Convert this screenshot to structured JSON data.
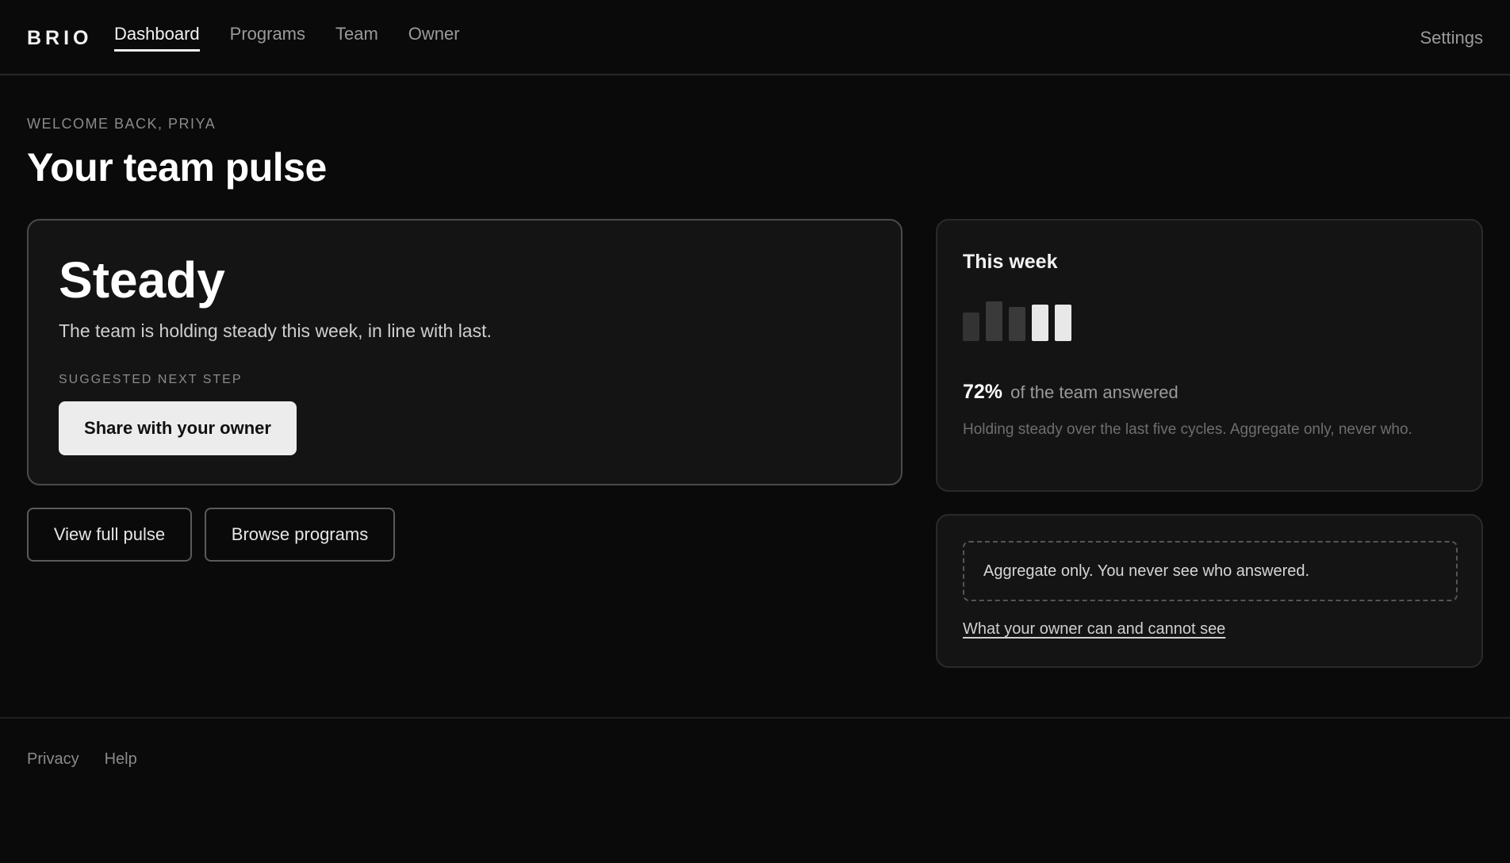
{
  "nav": {
    "brand": "BRIO",
    "links": [
      {
        "label": "Dashboard",
        "active": true
      },
      {
        "label": "Programs",
        "active": false
      },
      {
        "label": "Team",
        "active": false
      },
      {
        "label": "Owner",
        "active": false
      }
    ],
    "settings": "Settings"
  },
  "header": {
    "eyebrow": "WELCOME BACK, PRIYA",
    "title": "Your team pulse"
  },
  "pulse": {
    "status": "Steady",
    "description": "The team is holding steady this week, in line with last.",
    "next_step_label": "SUGGESTED NEXT STEP",
    "share_button": "Share with your owner"
  },
  "actions": {
    "view_full": "View full pulse",
    "browse": "Browse programs"
  },
  "this_week": {
    "title": "This week",
    "percent": "72%",
    "percent_suffix": "of the team answered",
    "note": "Holding steady over the last five cycles. Aggregate only, never who."
  },
  "chart_data": {
    "type": "bar",
    "values": [
      36,
      50,
      43,
      46,
      46
    ],
    "colors": [
      "#333333",
      "#3a3a3a",
      "#3a3a3a",
      "#e8e8e8",
      "#e8e8e8"
    ],
    "ylim": [
      0,
      50
    ]
  },
  "privacy": {
    "notice": "Aggregate only. You never see who answered.",
    "link": "What your owner can and cannot see"
  },
  "footer": {
    "privacy": "Privacy",
    "help": "Help"
  },
  "colors": {
    "background": "#0a0a0a",
    "card": "#141414",
    "accent": "#ececec"
  }
}
